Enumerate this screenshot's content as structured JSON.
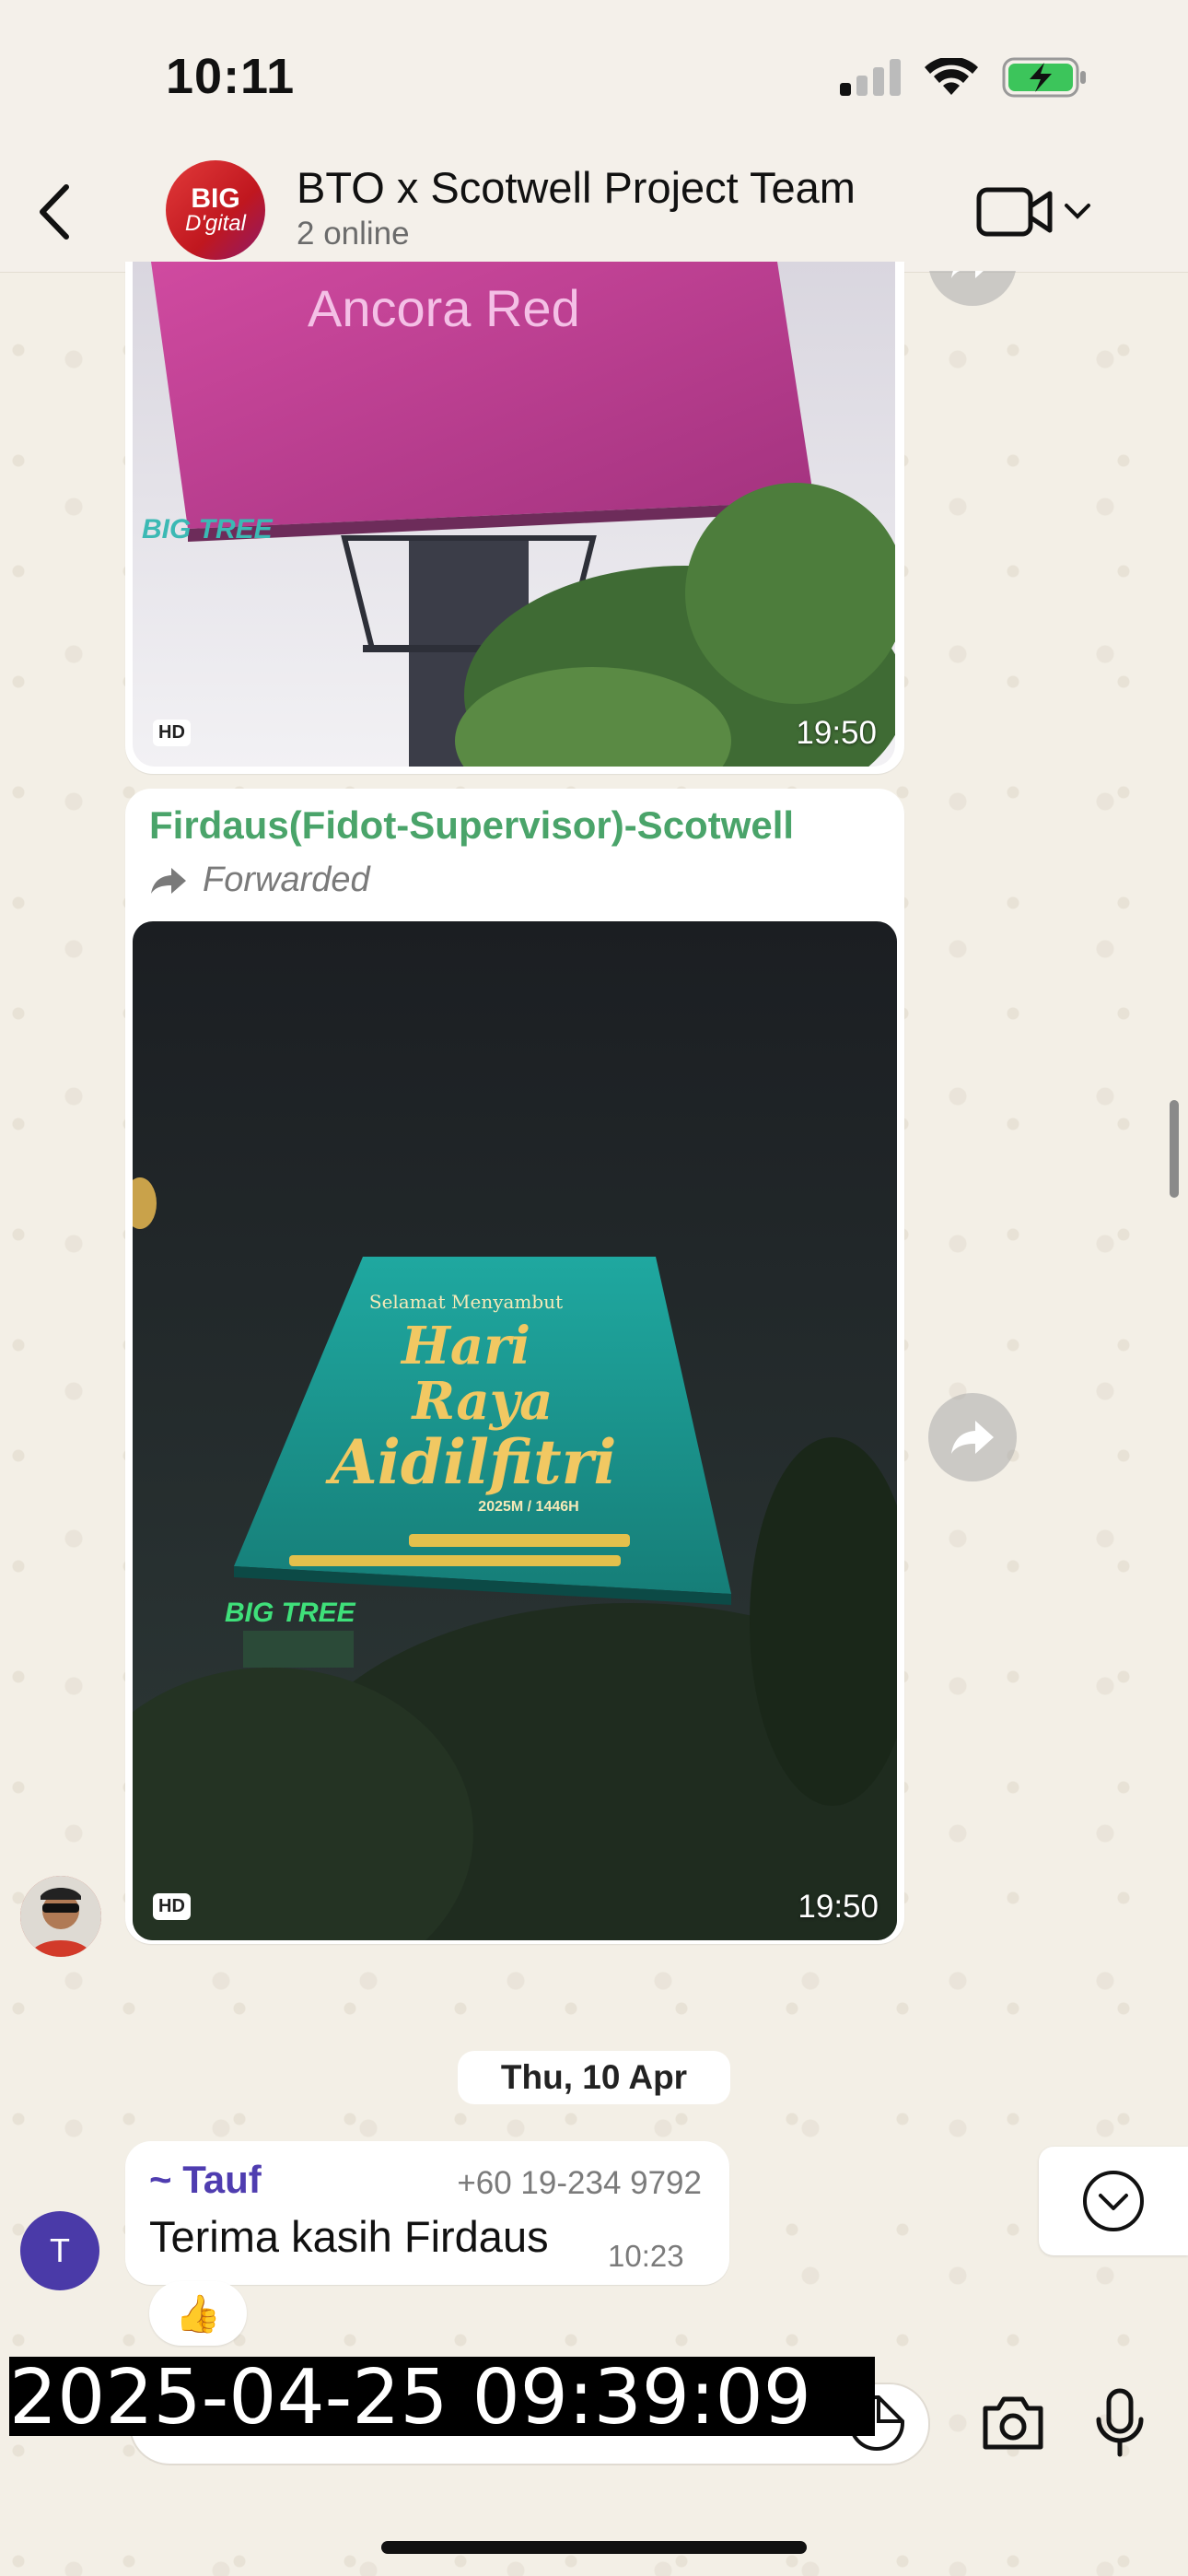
{
  "status_bar": {
    "time": "10:11"
  },
  "header": {
    "group_avatar_line1": "BIG",
    "group_avatar_line2": "D'gital",
    "title": "BTO x Scotwell Project Team",
    "subtitle": "2 online"
  },
  "messages": [
    {
      "type": "photo",
      "caption_on_image": "Ancora Red",
      "brand_on_image": "BIG TREE",
      "hd_label": "HD",
      "time": "19:50"
    },
    {
      "type": "photo",
      "sender": "Firdaus(Fidot-Supervisor)-Scotwell",
      "forwarded_label": "Forwarded",
      "billboard_title_line1": "Hari",
      "billboard_title_line2": "Raya",
      "billboard_title_line3": "Aidilfitri",
      "billboard_small_text": "2025M / 1446H",
      "billboard_header": "Selamat Menyambut",
      "brand_on_image": "BIG TREE",
      "hd_label": "HD",
      "time": "19:50"
    }
  ],
  "date_separator": "Thu, 10 Apr",
  "last_message": {
    "avatar_initial": "T",
    "sender": "~ Tauf",
    "phone": "+60 19-234 9792",
    "text": "Terima kasih Firdaus",
    "time": "10:23",
    "reaction": "👍"
  },
  "overlay_timestamp": "2025-04-25 09:39:09",
  "icons": {
    "back": "chevron-left-icon",
    "video": "video-camera-icon",
    "forward": "forward-arrow-icon",
    "scroll_down": "chevron-down-circle-icon",
    "camera": "camera-icon",
    "mic": "microphone-icon",
    "sticker": "sticker-icon"
  },
  "colors": {
    "sender_green": "#4aa46a",
    "tauf_purple": "#4f3db0",
    "avatar_purple": "#4a3aa8"
  }
}
